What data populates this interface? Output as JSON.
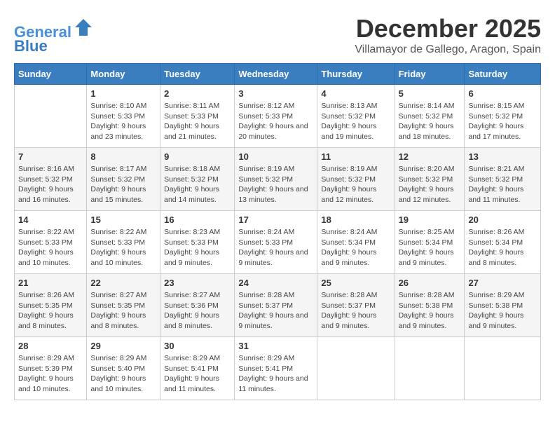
{
  "logo": {
    "line1": "General",
    "line2": "Blue"
  },
  "title": "December 2025",
  "location": "Villamayor de Gallego, Aragon, Spain",
  "weekdays": [
    "Sunday",
    "Monday",
    "Tuesday",
    "Wednesday",
    "Thursday",
    "Friday",
    "Saturday"
  ],
  "weeks": [
    [
      {
        "day": "",
        "sunrise": "",
        "sunset": "",
        "daylight": ""
      },
      {
        "day": "1",
        "sunrise": "Sunrise: 8:10 AM",
        "sunset": "Sunset: 5:33 PM",
        "daylight": "Daylight: 9 hours and 23 minutes."
      },
      {
        "day": "2",
        "sunrise": "Sunrise: 8:11 AM",
        "sunset": "Sunset: 5:33 PM",
        "daylight": "Daylight: 9 hours and 21 minutes."
      },
      {
        "day": "3",
        "sunrise": "Sunrise: 8:12 AM",
        "sunset": "Sunset: 5:33 PM",
        "daylight": "Daylight: 9 hours and 20 minutes."
      },
      {
        "day": "4",
        "sunrise": "Sunrise: 8:13 AM",
        "sunset": "Sunset: 5:32 PM",
        "daylight": "Daylight: 9 hours and 19 minutes."
      },
      {
        "day": "5",
        "sunrise": "Sunrise: 8:14 AM",
        "sunset": "Sunset: 5:32 PM",
        "daylight": "Daylight: 9 hours and 18 minutes."
      },
      {
        "day": "6",
        "sunrise": "Sunrise: 8:15 AM",
        "sunset": "Sunset: 5:32 PM",
        "daylight": "Daylight: 9 hours and 17 minutes."
      }
    ],
    [
      {
        "day": "7",
        "sunrise": "Sunrise: 8:16 AM",
        "sunset": "Sunset: 5:32 PM",
        "daylight": "Daylight: 9 hours and 16 minutes."
      },
      {
        "day": "8",
        "sunrise": "Sunrise: 8:17 AM",
        "sunset": "Sunset: 5:32 PM",
        "daylight": "Daylight: 9 hours and 15 minutes."
      },
      {
        "day": "9",
        "sunrise": "Sunrise: 8:18 AM",
        "sunset": "Sunset: 5:32 PM",
        "daylight": "Daylight: 9 hours and 14 minutes."
      },
      {
        "day": "10",
        "sunrise": "Sunrise: 8:19 AM",
        "sunset": "Sunset: 5:32 PM",
        "daylight": "Daylight: 9 hours and 13 minutes."
      },
      {
        "day": "11",
        "sunrise": "Sunrise: 8:19 AM",
        "sunset": "Sunset: 5:32 PM",
        "daylight": "Daylight: 9 hours and 12 minutes."
      },
      {
        "day": "12",
        "sunrise": "Sunrise: 8:20 AM",
        "sunset": "Sunset: 5:32 PM",
        "daylight": "Daylight: 9 hours and 12 minutes."
      },
      {
        "day": "13",
        "sunrise": "Sunrise: 8:21 AM",
        "sunset": "Sunset: 5:32 PM",
        "daylight": "Daylight: 9 hours and 11 minutes."
      }
    ],
    [
      {
        "day": "14",
        "sunrise": "Sunrise: 8:22 AM",
        "sunset": "Sunset: 5:33 PM",
        "daylight": "Daylight: 9 hours and 10 minutes."
      },
      {
        "day": "15",
        "sunrise": "Sunrise: 8:22 AM",
        "sunset": "Sunset: 5:33 PM",
        "daylight": "Daylight: 9 hours and 10 minutes."
      },
      {
        "day": "16",
        "sunrise": "Sunrise: 8:23 AM",
        "sunset": "Sunset: 5:33 PM",
        "daylight": "Daylight: 9 hours and 9 minutes."
      },
      {
        "day": "17",
        "sunrise": "Sunrise: 8:24 AM",
        "sunset": "Sunset: 5:33 PM",
        "daylight": "Daylight: 9 hours and 9 minutes."
      },
      {
        "day": "18",
        "sunrise": "Sunrise: 8:24 AM",
        "sunset": "Sunset: 5:34 PM",
        "daylight": "Daylight: 9 hours and 9 minutes."
      },
      {
        "day": "19",
        "sunrise": "Sunrise: 8:25 AM",
        "sunset": "Sunset: 5:34 PM",
        "daylight": "Daylight: 9 hours and 9 minutes."
      },
      {
        "day": "20",
        "sunrise": "Sunrise: 8:26 AM",
        "sunset": "Sunset: 5:34 PM",
        "daylight": "Daylight: 9 hours and 8 minutes."
      }
    ],
    [
      {
        "day": "21",
        "sunrise": "Sunrise: 8:26 AM",
        "sunset": "Sunset: 5:35 PM",
        "daylight": "Daylight: 9 hours and 8 minutes."
      },
      {
        "day": "22",
        "sunrise": "Sunrise: 8:27 AM",
        "sunset": "Sunset: 5:35 PM",
        "daylight": "Daylight: 9 hours and 8 minutes."
      },
      {
        "day": "23",
        "sunrise": "Sunrise: 8:27 AM",
        "sunset": "Sunset: 5:36 PM",
        "daylight": "Daylight: 9 hours and 8 minutes."
      },
      {
        "day": "24",
        "sunrise": "Sunrise: 8:28 AM",
        "sunset": "Sunset: 5:37 PM",
        "daylight": "Daylight: 9 hours and 9 minutes."
      },
      {
        "day": "25",
        "sunrise": "Sunrise: 8:28 AM",
        "sunset": "Sunset: 5:37 PM",
        "daylight": "Daylight: 9 hours and 9 minutes."
      },
      {
        "day": "26",
        "sunrise": "Sunrise: 8:28 AM",
        "sunset": "Sunset: 5:38 PM",
        "daylight": "Daylight: 9 hours and 9 minutes."
      },
      {
        "day": "27",
        "sunrise": "Sunrise: 8:29 AM",
        "sunset": "Sunset: 5:38 PM",
        "daylight": "Daylight: 9 hours and 9 minutes."
      }
    ],
    [
      {
        "day": "28",
        "sunrise": "Sunrise: 8:29 AM",
        "sunset": "Sunset: 5:39 PM",
        "daylight": "Daylight: 9 hours and 10 minutes."
      },
      {
        "day": "29",
        "sunrise": "Sunrise: 8:29 AM",
        "sunset": "Sunset: 5:40 PM",
        "daylight": "Daylight: 9 hours and 10 minutes."
      },
      {
        "day": "30",
        "sunrise": "Sunrise: 8:29 AM",
        "sunset": "Sunset: 5:41 PM",
        "daylight": "Daylight: 9 hours and 11 minutes."
      },
      {
        "day": "31",
        "sunrise": "Sunrise: 8:29 AM",
        "sunset": "Sunset: 5:41 PM",
        "daylight": "Daylight: 9 hours and 11 minutes."
      },
      {
        "day": "",
        "sunrise": "",
        "sunset": "",
        "daylight": ""
      },
      {
        "day": "",
        "sunrise": "",
        "sunset": "",
        "daylight": ""
      },
      {
        "day": "",
        "sunrise": "",
        "sunset": "",
        "daylight": ""
      }
    ]
  ]
}
